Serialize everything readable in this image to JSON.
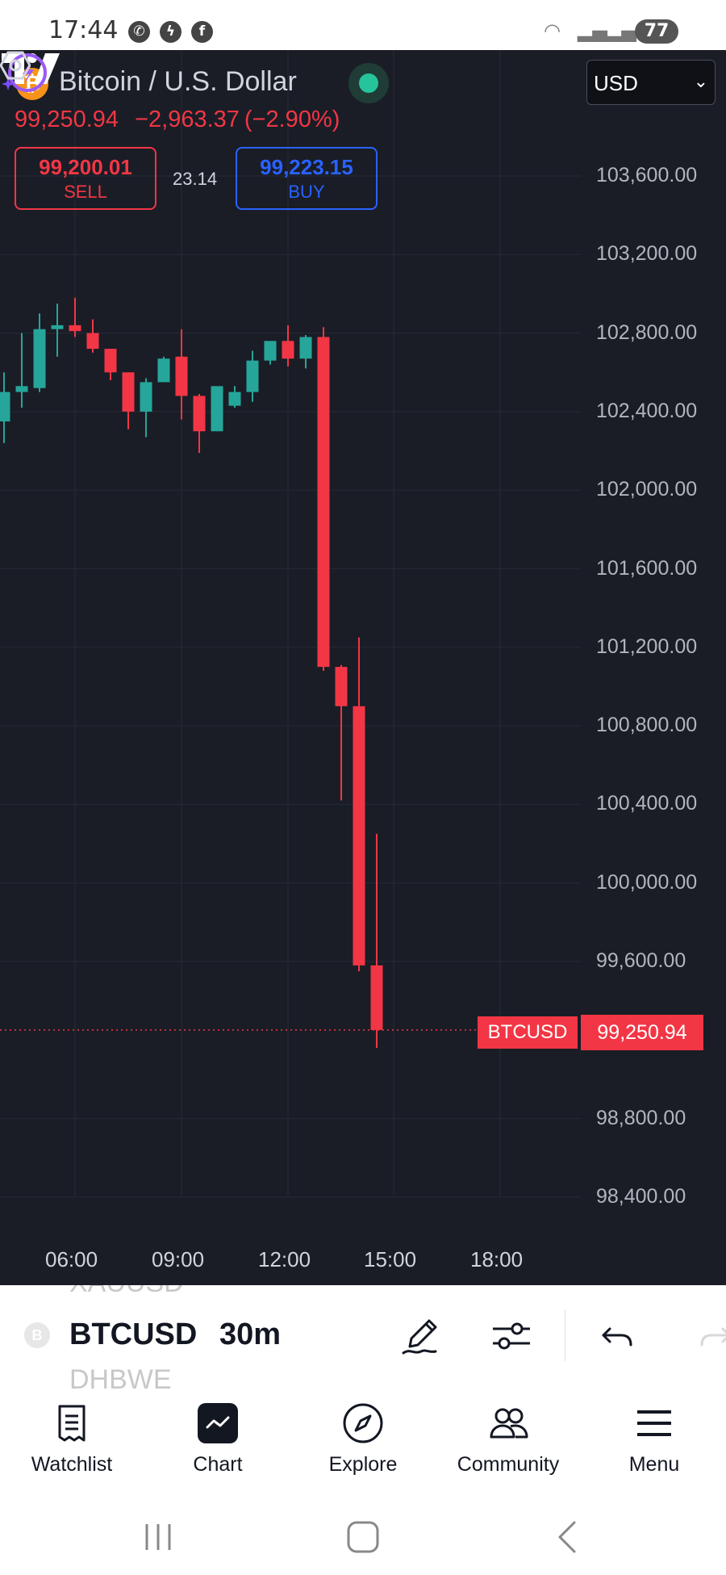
{
  "status_bar": {
    "time": "17:44",
    "battery": "77"
  },
  "header": {
    "instrument_title": "Bitcoin / U.S. Dollar",
    "currency": "USD",
    "last_price": "99,250.94",
    "change": "−2,963.37",
    "change_pct": "(−2.90%)",
    "sell_price": "99,200.01",
    "sell_label": "SELL",
    "spread": "23.14",
    "buy_price": "99,223.15",
    "buy_label": "BUY"
  },
  "chart_data": {
    "type": "candlestick",
    "symbol": "BTCUSD",
    "interval": "30m",
    "y_ticks": [
      103600,
      103200,
      102800,
      102400,
      102000,
      101600,
      101200,
      100800,
      100400,
      100000,
      99600,
      98800,
      98400
    ],
    "y_tick_labels": [
      "103,600.00",
      "103,200.00",
      "102,800.00",
      "102,400.00",
      "102,000.00",
      "101,600.00",
      "101,200.00",
      "100,800.00",
      "100,400.00",
      "100,000.00",
      "99,600.00",
      "98,800.00",
      "98,400.00"
    ],
    "ylim": [
      98200,
      104000
    ],
    "x_ticks": [
      "06:00",
      "09:00",
      "12:00",
      "15:00",
      "18:00"
    ],
    "last_price": 99250.94,
    "last_price_label": "99,250.94",
    "symbol_tag": "BTCUSD",
    "candles": [
      {
        "time": "04:00",
        "o": 102350,
        "h": 102600,
        "l": 102240,
        "c": 102500
      },
      {
        "time": "04:30",
        "o": 102500,
        "h": 102800,
        "l": 102420,
        "c": 102530
      },
      {
        "time": "05:00",
        "o": 102520,
        "h": 102900,
        "l": 102500,
        "c": 102820
      },
      {
        "time": "05:30",
        "o": 102820,
        "h": 102950,
        "l": 102680,
        "c": 102840
      },
      {
        "time": "06:00",
        "o": 102840,
        "h": 102980,
        "l": 102780,
        "c": 102810
      },
      {
        "time": "06:30",
        "o": 102800,
        "h": 102870,
        "l": 102700,
        "c": 102720
      },
      {
        "time": "07:00",
        "o": 102720,
        "h": 102720,
        "l": 102560,
        "c": 102600
      },
      {
        "time": "07:30",
        "o": 102600,
        "h": 102600,
        "l": 102310,
        "c": 102400
      },
      {
        "time": "08:00",
        "o": 102400,
        "h": 102570,
        "l": 102270,
        "c": 102550
      },
      {
        "time": "08:30",
        "o": 102550,
        "h": 102680,
        "l": 102550,
        "c": 102670
      },
      {
        "time": "09:00",
        "o": 102680,
        "h": 102820,
        "l": 102360,
        "c": 102480
      },
      {
        "time": "09:30",
        "o": 102480,
        "h": 102490,
        "l": 102190,
        "c": 102300
      },
      {
        "time": "10:00",
        "o": 102300,
        "h": 102460,
        "l": 102300,
        "c": 102530
      },
      {
        "time": "10:30",
        "o": 102430,
        "h": 102530,
        "l": 102420,
        "c": 102500
      },
      {
        "time": "11:00",
        "o": 102500,
        "h": 102710,
        "l": 102450,
        "c": 102660
      },
      {
        "time": "11:30",
        "o": 102660,
        "h": 102750,
        "l": 102640,
        "c": 102760
      },
      {
        "time": "12:00",
        "o": 102760,
        "h": 102840,
        "l": 102630,
        "c": 102670
      },
      {
        "time": "12:30",
        "o": 102670,
        "h": 102790,
        "l": 102620,
        "c": 102780
      },
      {
        "time": "13:00",
        "o": 102780,
        "h": 102830,
        "l": 101080,
        "c": 101100
      },
      {
        "time": "13:30",
        "o": 101100,
        "h": 101110,
        "l": 100420,
        "c": 100900
      },
      {
        "time": "14:00",
        "o": 100900,
        "h": 101250,
        "l": 99550,
        "c": 99580
      },
      {
        "time": "14:30",
        "o": 99580,
        "h": 100250,
        "l": 99160,
        "c": 99250.94
      }
    ]
  },
  "toolbar": {
    "symbol": "BTCUSD",
    "symbol_prev": "XAUUSD",
    "symbol_next": "DHBWE",
    "interval": "30m",
    "coin_letter": "B"
  },
  "nav": {
    "watchlist": "Watchlist",
    "chart": "Chart",
    "explore": "Explore",
    "community": "Community",
    "menu": "Menu"
  },
  "colors": {
    "up": "#26a69a",
    "down": "#f23645",
    "background": "#1a1d26",
    "grid": "#262a36"
  },
  "icons": [
    "whatsapp-icon",
    "messenger-icon",
    "facebook-icon",
    "wifi-icon",
    "signal-icon",
    "pencil-icon",
    "sliders-icon",
    "undo-icon",
    "redo-icon",
    "settings-icon"
  ]
}
